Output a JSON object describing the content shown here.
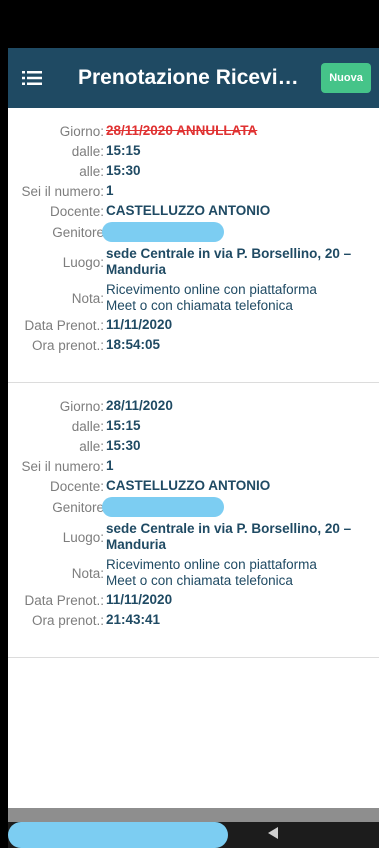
{
  "header": {
    "title": "Prenotazione Ricevimento",
    "new_button": "Nuova",
    "menu_icon": "menu-icon"
  },
  "labels": {
    "giorno": "Giorno:",
    "dalle": "dalle:",
    "alle": "alle:",
    "numero": "Sei il numero:",
    "docente": "Docente:",
    "genitore": "Genitore",
    "luogo": "Luogo:",
    "nota": "Nota:",
    "data_prenot": "Data Prenot.:",
    "ora_prenot": "Ora prenot.:"
  },
  "bookings": [
    {
      "giorno": "28/11/2020 ANNULLATA",
      "dalle": "15:15",
      "alle": "15:30",
      "numero": "1",
      "docente": "CASTELLUZZO ANTONIO",
      "luogo_1": "sede Centrale in via P. Borsellino, 20 –",
      "luogo_2": "Manduria",
      "nota_1": "Ricevimento online con piattaforma",
      "nota_2": "Meet o con chiamata telefonica",
      "data_prenot": "11/11/2020",
      "ora_prenot": "18:54:05",
      "cancelled": true
    },
    {
      "giorno": "28/11/2020",
      "dalle": "15:15",
      "alle": "15:30",
      "numero": "1",
      "docente": "CASTELLUZZO ANTONIO",
      "luogo_1": "sede Centrale in via P. Borsellino, 20 –",
      "luogo_2": "Manduria",
      "nota_1": "Ricevimento online con piattaforma",
      "nota_2": "Meet o con chiamata telefonica",
      "data_prenot": "11/11/2020",
      "ora_prenot": "21:43:41",
      "cancelled": false
    }
  ],
  "colors": {
    "header_bg": "#1f4a63",
    "accent_green": "#45c489",
    "value_text": "#1f4a63",
    "cancelled_red": "#e03232"
  }
}
